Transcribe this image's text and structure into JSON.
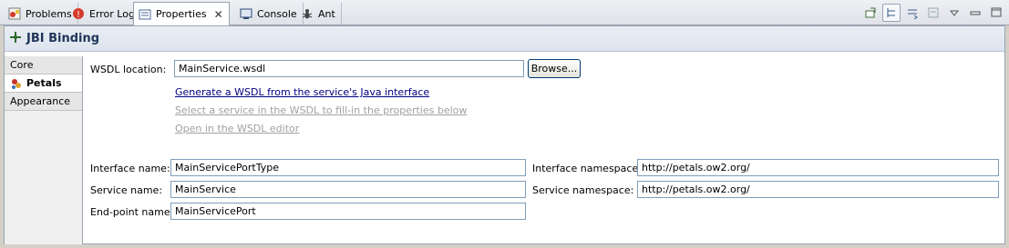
{
  "tabs": [
    {
      "label": "Problems",
      "icon": "problems-icon"
    },
    {
      "label": "Error Log",
      "icon": "error-log-icon"
    },
    {
      "label": "Properties",
      "icon": "properties-icon",
      "active": true
    },
    {
      "label": "Console",
      "icon": "console-icon"
    },
    {
      "label": "Ant",
      "icon": "ant-icon"
    }
  ],
  "header": {
    "title": "JBI Binding"
  },
  "categories": [
    {
      "label": "Core"
    },
    {
      "label": "Petals",
      "selected": true
    },
    {
      "label": "Appearance"
    }
  ],
  "form": {
    "wsdl_label": "WSDL location:",
    "wsdl_value": "MainService.wsdl",
    "browse_label": "Browse...",
    "link_generate": "Generate a WSDL from the service's Java interface",
    "link_select": "Select a service in the WSDL to fill-in the properties below",
    "link_open": "Open in the WSDL editor",
    "interface_name_label": "Interface name:",
    "interface_name_value": "MainServicePortType",
    "service_name_label": "Service name:",
    "service_name_value": "MainService",
    "endpoint_label": "End-point name:",
    "endpoint_value": "MainServicePort",
    "interface_ns_label": "Interface namespace:",
    "interface_ns_value": "http://petals.ow2.org/",
    "service_ns_label": "Service namespace:",
    "service_ns_value": "http://petals.ow2.org/"
  },
  "colors": {
    "link": "#00007f",
    "link_disabled": "#a0a0a0",
    "header_title": "#1f3558"
  }
}
